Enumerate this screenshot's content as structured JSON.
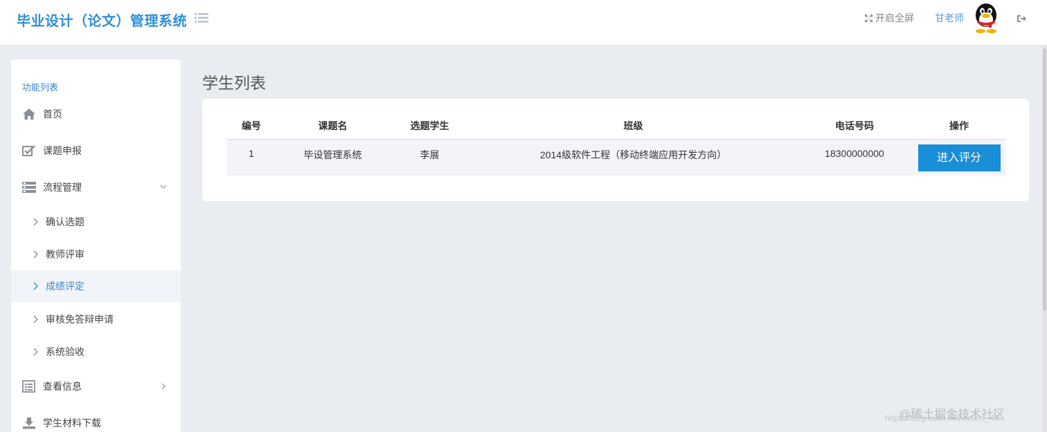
{
  "header": {
    "title": "毕业设计（论文）管理系统",
    "fullscreen_label": "开启全屏",
    "username": "甘老师"
  },
  "sidebar": {
    "heading": "功能列表",
    "items": [
      {
        "label": "首页",
        "icon": "home-icon"
      },
      {
        "label": "课题申报",
        "icon": "checkbox-icon"
      },
      {
        "label": "流程管理",
        "icon": "list-icon",
        "expanded": true
      },
      {
        "label": "查看信息",
        "icon": "table-icon"
      },
      {
        "label": "学生材料下载",
        "icon": "download-icon"
      }
    ],
    "subitems": [
      {
        "label": "确认选题"
      },
      {
        "label": "教师评审"
      },
      {
        "label": "成绩评定",
        "active": true
      },
      {
        "label": "审核免答辩申请"
      },
      {
        "label": "系统验收"
      }
    ]
  },
  "main": {
    "page_title": "学生列表",
    "table": {
      "headers": [
        "编号",
        "课题名",
        "选题学生",
        "班级",
        "电话号码",
        "操作"
      ],
      "rows": [
        {
          "id": "1",
          "topic": "毕设管理系统",
          "student": "李展",
          "class": "2014级软件工程（移动终端应用开发方向）",
          "phone": "18300000000",
          "action_label": "进入评分"
        }
      ]
    }
  },
  "colors": {
    "accent": "#2f8fd8",
    "button": "#1a8ed6",
    "background": "#e9ecf1"
  },
  "watermark": {
    "text": "@稀土掘金技术社区",
    "url": "https://blog.csdn.net/weixin_43..."
  }
}
